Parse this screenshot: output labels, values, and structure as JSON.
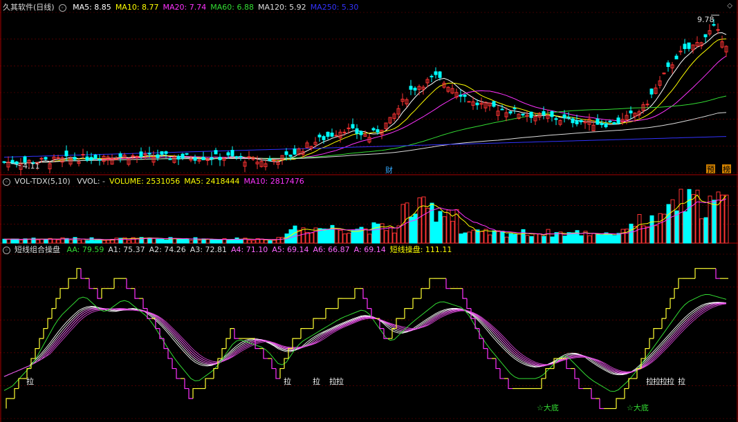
{
  "chart_data": [
    {
      "type": "candlestick",
      "panel": "price",
      "title": "久其软件(日线)",
      "ma_labels": [
        {
          "text": "MA5: 8.85",
          "color": "#ffffff"
        },
        {
          "text": "MA10: 8.77",
          "color": "#ffff00"
        },
        {
          "text": "MA20: 7.74",
          "color": "#ff33ff"
        },
        {
          "text": "MA60: 6.88",
          "color": "#33dd33"
        },
        {
          "text": "MA120: 5.92",
          "color": "#dddddd"
        },
        {
          "text": "MA250: 5.30",
          "color": "#3333ff"
        }
      ],
      "ylim": [
        3.9,
        10.1
      ],
      "high_label": "9.78",
      "low_label": "4.11",
      "markers": {
        "cai": "财",
        "yu": "预",
        "bang": "榜"
      },
      "note": "price series shape approximated from visual"
    },
    {
      "type": "bar",
      "panel": "volume",
      "title": "VOL-TDX(5,10)",
      "labels": [
        {
          "text": "VVOL: -",
          "color": "#dddddd"
        },
        {
          "text": "VOLUME: 2531056",
          "color": "#ffff00"
        },
        {
          "text": "MA5: 2418444",
          "color": "#ffff00"
        },
        {
          "text": "MA10: 2817476",
          "color": "#ff33ff"
        }
      ]
    },
    {
      "type": "line",
      "panel": "indicator",
      "title": "短线组合操盘",
      "labels": [
        {
          "text": "AA: 79.59",
          "color": "#33dd33"
        },
        {
          "text": "A1: 75.37",
          "color": "#dddddd"
        },
        {
          "text": "A2: 74.26",
          "color": "#dddddd"
        },
        {
          "text": "A3: 72.81",
          "color": "#dddddd"
        },
        {
          "text": "A4: 71.10",
          "color": "#ff66ff"
        },
        {
          "text": "A5: 69.14",
          "color": "#ff66ff"
        },
        {
          "text": "A6: 66.87",
          "color": "#ff66ff"
        },
        {
          "text": "A: 69.14",
          "color": "#ff66ff"
        },
        {
          "text": "短线操盘: 111.11",
          "color": "#ffff00"
        }
      ],
      "signal_la": "拉",
      "signal_dadi": "☆大底"
    }
  ],
  "colors": {
    "up": "#ff3333",
    "down": "#00ffff",
    "grid": "#7a0000",
    "sep": "#aa0000"
  }
}
